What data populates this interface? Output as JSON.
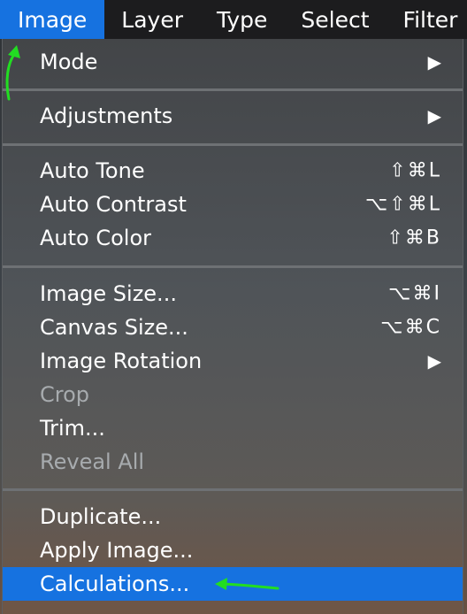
{
  "menubar": {
    "items": [
      {
        "label": "Image",
        "active": true
      },
      {
        "label": "Layer",
        "active": false
      },
      {
        "label": "Type",
        "active": false
      },
      {
        "label": "Select",
        "active": false
      },
      {
        "label": "Filter",
        "active": false
      }
    ]
  },
  "menu": {
    "mode": {
      "label": "Mode",
      "icon": "submenu-arrow"
    },
    "adjustments": {
      "label": "Adjustments",
      "icon": "submenu-arrow"
    },
    "auto_tone": {
      "label": "Auto Tone",
      "shortcut": "⇧⌘L"
    },
    "auto_contrast": {
      "label": "Auto Contrast",
      "shortcut": "⌥⇧⌘L"
    },
    "auto_color": {
      "label": "Auto Color",
      "shortcut": "⇧⌘B"
    },
    "image_size": {
      "label": "Image Size...",
      "shortcut": "⌥⌘I"
    },
    "canvas_size": {
      "label": "Canvas Size...",
      "shortcut": "⌥⌘C"
    },
    "image_rotation": {
      "label": "Image Rotation",
      "icon": "submenu-arrow"
    },
    "crop": {
      "label": "Crop",
      "disabled": true
    },
    "trim": {
      "label": "Trim..."
    },
    "reveal_all": {
      "label": "Reveal All",
      "disabled": true
    },
    "duplicate": {
      "label": "Duplicate..."
    },
    "apply_image": {
      "label": "Apply Image..."
    },
    "calculations": {
      "label": "Calculations...",
      "highlighted": true
    }
  },
  "colors": {
    "accent": "#1672e0",
    "annotation_arrow": "#22dd22"
  }
}
